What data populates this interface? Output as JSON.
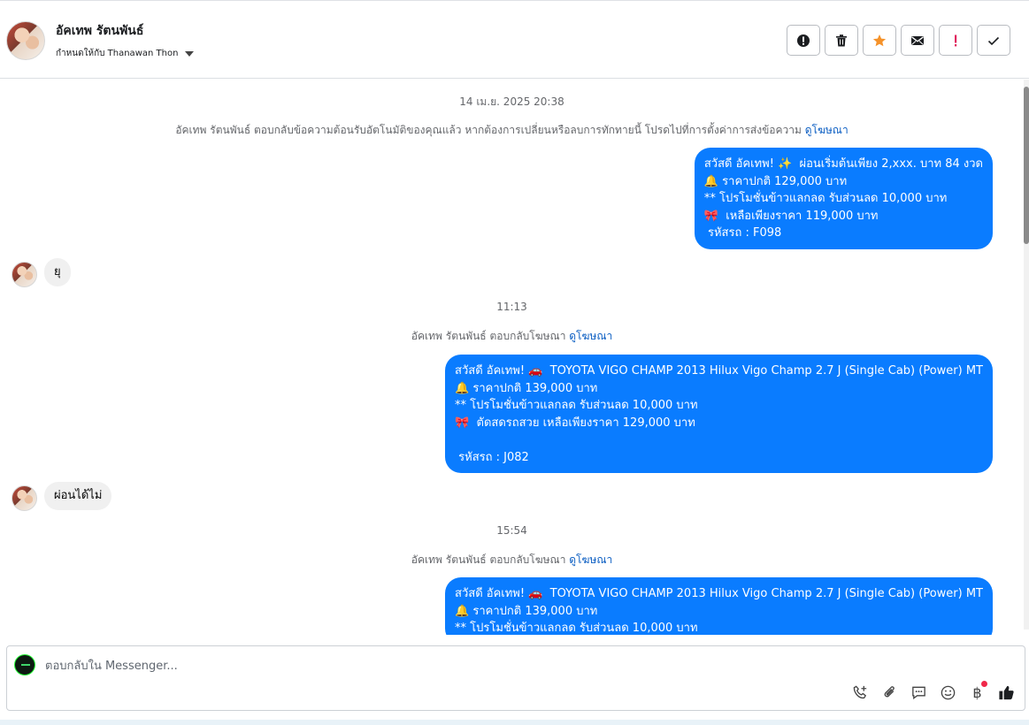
{
  "header": {
    "contact_name": "อัคเทพ รัตนพันธ์",
    "assigned_label": "กำหนดให้กับ Thanawan Thon",
    "actions": [
      {
        "name": "spam-info-button",
        "icon": "exclamation-circle-icon"
      },
      {
        "name": "delete-button",
        "icon": "trash-icon"
      },
      {
        "name": "star-button",
        "icon": "star-icon",
        "color": "#f5922a"
      },
      {
        "name": "mark-unread-button",
        "icon": "envelope-icon"
      },
      {
        "name": "follow-up-button",
        "icon": "exclamation-icon",
        "color": "#e0245e"
      },
      {
        "name": "mark-done-button",
        "icon": "checkmark-icon"
      }
    ]
  },
  "messages": {
    "ts1": "14 เม.ย. 2025 20:38",
    "system1_text": "อัคเทพ รัตนพันธ์ ตอบกลับข้อความต้อนรับอัตโนมัติของคุณแล้ว หากต้องการเปลี่ยนหรือลบการทักทายนี้ โปรดไปที่การตั้งค่าการส่งข้อความ",
    "system1_link": "ดูโฆษณา",
    "out1": "สวัสดี อัคเทพ! ✨  ผ่อนเริ่มต้นเพียง 2,xxx. บาท 84 งวด\n🔔 ราคาปกติ 129,000 บาท\n** โปรโมชั่นข้าวแลกลด รับส่วนลด 10,000 บาท\n🎀  เหลือเพียงราคา 119,000 บาท\n รหัสรถ : F098",
    "in1": "ยุ",
    "ts2": "11:13",
    "system2_text": "อัคเทพ รัตนพันธ์ ตอบกลับโฆษณา",
    "system2_link": "ดูโฆษณา",
    "out2": "สวัสดี อัคเทพ! 🚗  TOYOTA VIGO CHAMP 2013 Hilux Vigo Champ 2.7 J (Single Cab) (Power) MT\n🔔 ราคาปกติ 139,000 บาท\n** โปรโมชั่นข้าวแลกลด รับส่วนลด 10,000 บาท\n🎀  ตัดสดรถสวย เหลือเพียงราคา 129,000 บาท\n\n รหัสรถ : J082",
    "in2": "ผ่อนได้ไม่",
    "ts3": "15:54",
    "system3_text": "อัคเทพ รัตนพันธ์ ตอบกลับโฆษณา",
    "system3_link": "ดูโฆษณา",
    "out3": "สวัสดี อัคเทพ! 🚗  TOYOTA VIGO CHAMP 2013 Hilux Vigo Champ 2.7 J (Single Cab) (Power) MT\n🔔 ราคาปกติ 139,000 บาท\n** โปรโมชั่นข้าวแลกลด รับส่วนลด 10,000 บาท"
  },
  "composer": {
    "placeholder": "ตอบกลับใน Messenger...",
    "tools": [
      "call-add-icon",
      "paperclip-icon",
      "saved-reply-icon",
      "emoji-icon",
      "baht-payment-icon",
      "thumbs-up-icon"
    ],
    "baht_symbol": "฿"
  },
  "colors": {
    "outgoing_bubble": "#0a7cff",
    "incoming_bubble": "#f0f0f0",
    "link": "#0a5dc2"
  }
}
